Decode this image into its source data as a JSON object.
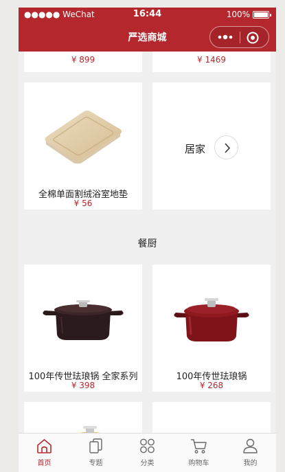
{
  "status_bar": {
    "carrier": "●●●●● WeChat",
    "time": "16:44",
    "battery": "100%"
  },
  "nav": {
    "title": "严选商城"
  },
  "top_row": {
    "left_price": "¥ 899",
    "right_price": "¥ 1469"
  },
  "products_home": [
    {
      "name": "全棉单面割绒浴室地垫",
      "price": "¥ 56"
    }
  ],
  "more_card": {
    "label": "居家"
  },
  "section": {
    "title": "餐厨"
  },
  "products_kitchen": [
    {
      "name": "100年传世珐琅锅 全家系列",
      "price": "¥ 398"
    },
    {
      "name": "100年传世珐琅锅",
      "price": "¥ 268"
    }
  ],
  "tabs": [
    {
      "label": "首页",
      "icon": "home-icon",
      "active": true
    },
    {
      "label": "专题",
      "icon": "topic-icon"
    },
    {
      "label": "分类",
      "icon": "category-icon"
    },
    {
      "label": "购物车",
      "icon": "cart-icon"
    },
    {
      "label": "我的",
      "icon": "profile-icon"
    }
  ],
  "colors": {
    "brand": "#b4282d",
    "background": "#f0f0f0"
  }
}
